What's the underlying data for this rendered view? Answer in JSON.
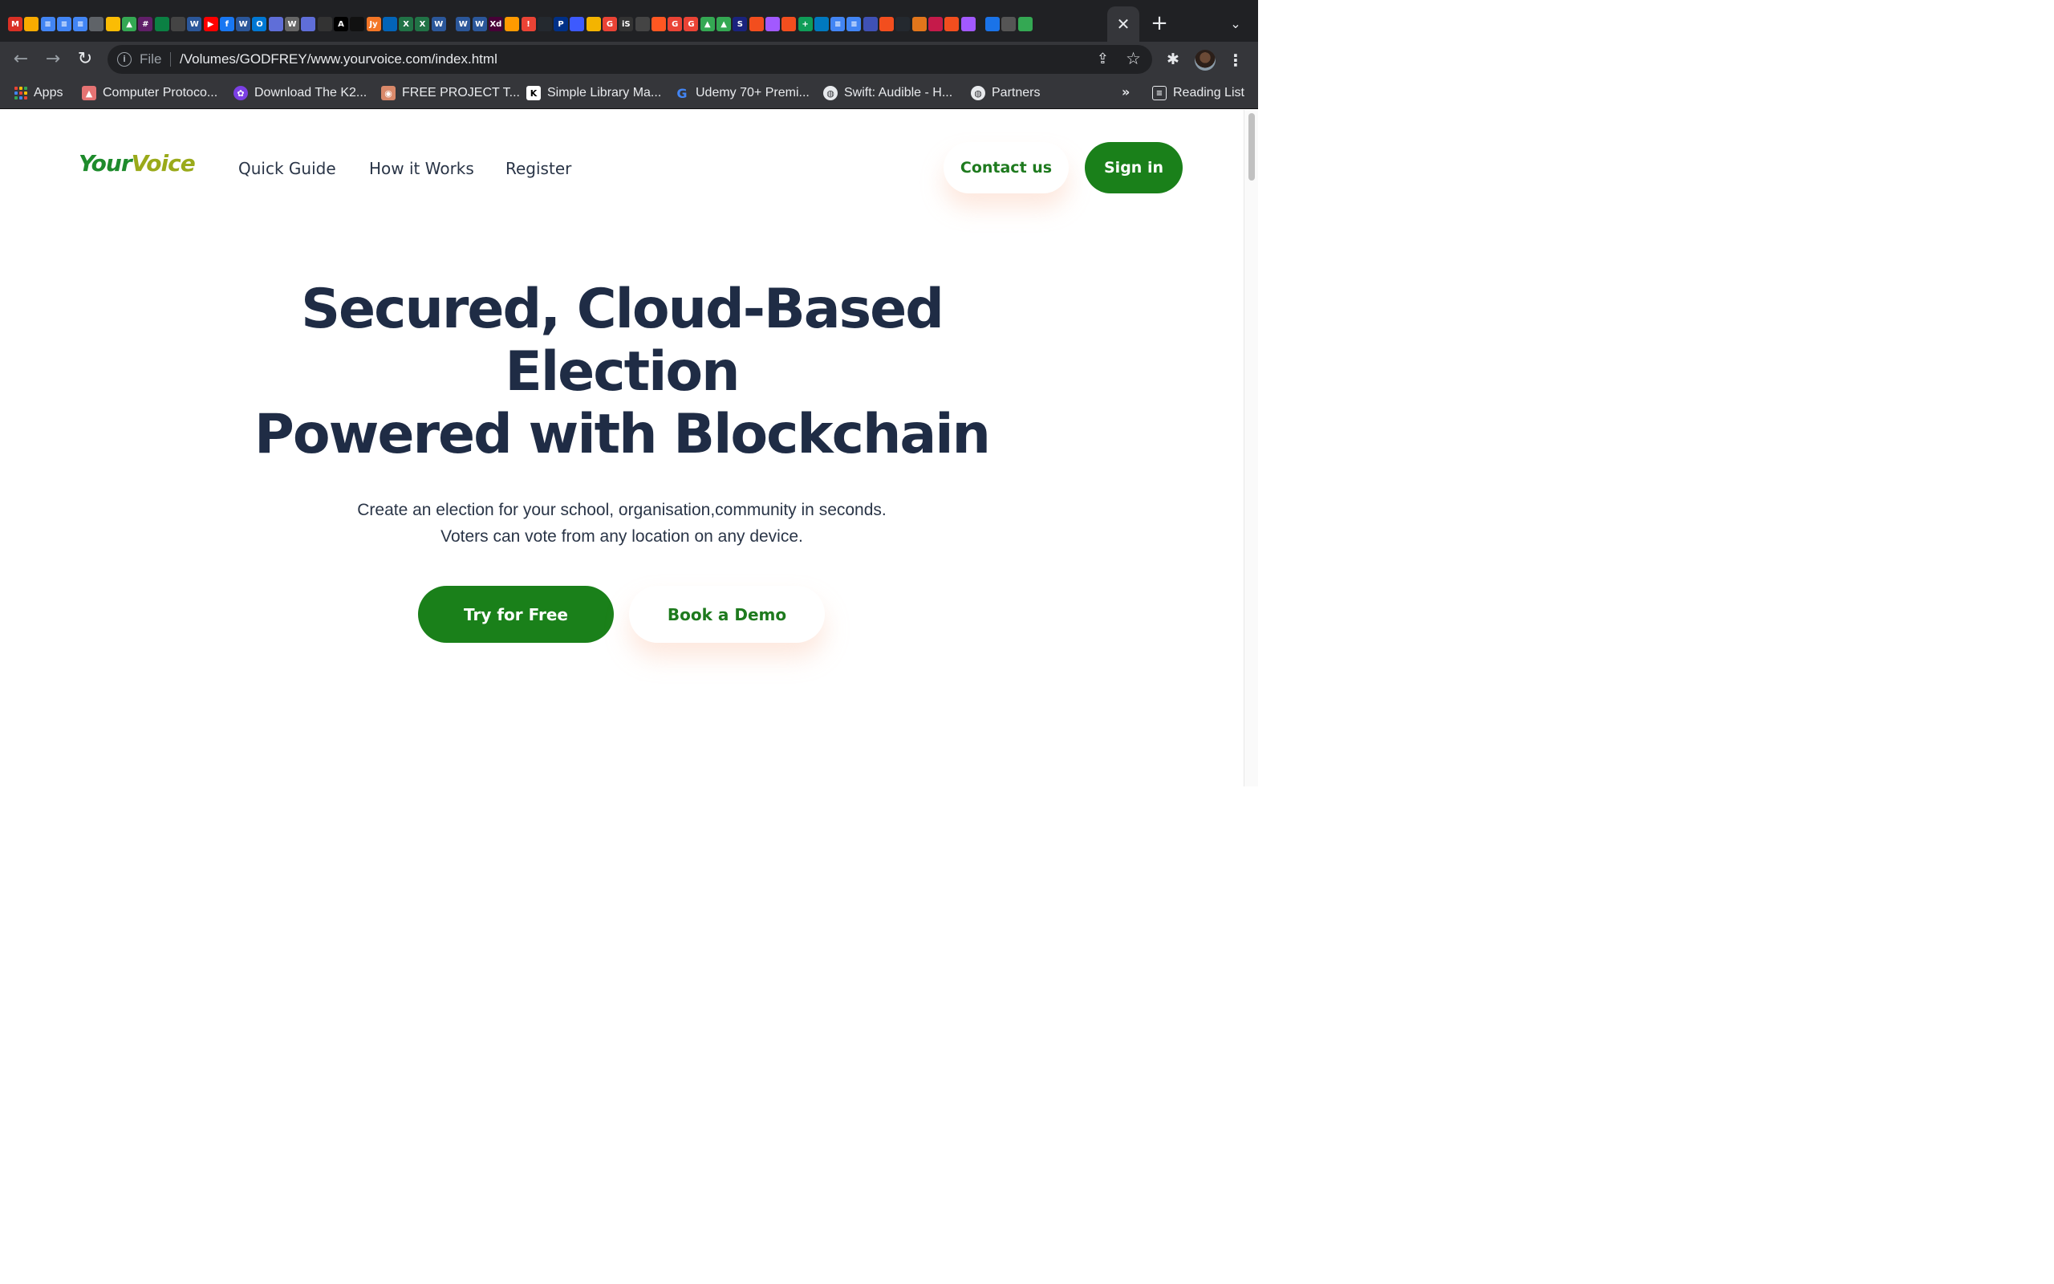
{
  "browser": {
    "tab_close_glyph": "✕",
    "new_tab_glyph": "+",
    "tab_search_glyph": "⌄",
    "tab_favicons": [
      {
        "name": "gmail-icon",
        "letter": "M",
        "color": "#d93025"
      },
      {
        "name": "notes-icon",
        "letter": "",
        "color": "#f9ab00"
      },
      {
        "name": "docs-icon",
        "letter": "≡",
        "color": "#4285f4"
      },
      {
        "name": "docs-icon",
        "letter": "≡",
        "color": "#4285f4"
      },
      {
        "name": "docs-icon",
        "letter": "≡",
        "color": "#4285f4"
      },
      {
        "name": "paper-icon",
        "letter": "",
        "color": "#5f6368"
      },
      {
        "name": "keep-icon",
        "letter": "",
        "color": "#fbbc04"
      },
      {
        "name": "drive-icon",
        "letter": "▲",
        "color": "#34a853"
      },
      {
        "name": "slack-icon",
        "letter": "#",
        "color": "#611f69"
      },
      {
        "name": "app-icon",
        "letter": "",
        "color": "#0b8043"
      },
      {
        "name": "app-icon",
        "letter": "",
        "color": "#444444"
      },
      {
        "name": "word-icon",
        "letter": "W",
        "color": "#2b579a"
      },
      {
        "name": "youtube-icon",
        "letter": "▶",
        "color": "#ff0000"
      },
      {
        "name": "facebook-icon",
        "letter": "f",
        "color": "#1877f2"
      },
      {
        "name": "word-icon",
        "letter": "W",
        "color": "#2b579a"
      },
      {
        "name": "outlook-icon",
        "letter": "O",
        "color": "#0078d4"
      },
      {
        "name": "app-icon",
        "letter": "",
        "color": "#5f6ed8"
      },
      {
        "name": "wikipedia-icon",
        "letter": "W",
        "color": "#666666"
      },
      {
        "name": "app-icon",
        "letter": "",
        "color": "#5f6ed8"
      },
      {
        "name": "app-icon",
        "letter": "",
        "color": "#333333"
      },
      {
        "name": "app-icon",
        "letter": "A",
        "color": "#000000"
      },
      {
        "name": "app-icon",
        "letter": "",
        "color": "#111111"
      },
      {
        "name": "app-icon",
        "letter": "Jy",
        "color": "#f37626"
      },
      {
        "name": "onedrive-icon",
        "letter": "",
        "color": "#0364b8"
      },
      {
        "name": "excel-icon",
        "letter": "X",
        "color": "#217346"
      },
      {
        "name": "excel-icon",
        "letter": "X",
        "color": "#217346"
      },
      {
        "name": "word-icon",
        "letter": "W",
        "color": "#2b579a"
      },
      {
        "name": "separator",
        "letter": "",
        "color": "sep"
      },
      {
        "name": "word-icon",
        "letter": "W",
        "color": "#2b579a"
      },
      {
        "name": "word-icon",
        "letter": "W",
        "color": "#2b579a"
      },
      {
        "name": "xd-icon",
        "letter": "Xd",
        "color": "#470137"
      },
      {
        "name": "app-icon",
        "letter": "",
        "color": "#ff9a00"
      },
      {
        "name": "app-icon",
        "letter": "!",
        "color": "#ea4335"
      },
      {
        "name": "github-icon",
        "letter": "",
        "color": "#24292f"
      },
      {
        "name": "paypal-icon",
        "letter": "P",
        "color": "#003087"
      },
      {
        "name": "app-icon",
        "letter": "",
        "color": "#3d5afe"
      },
      {
        "name": "app-icon",
        "letter": "",
        "color": "#f4b400"
      },
      {
        "name": "google-icon",
        "letter": "G",
        "color": "#ea4335"
      },
      {
        "name": "app-icon",
        "letter": "iS",
        "color": "#333333"
      },
      {
        "name": "app-icon",
        "letter": "",
        "color": "#444444"
      },
      {
        "name": "app-icon",
        "letter": "",
        "color": "#ff5722"
      },
      {
        "name": "google-icon",
        "letter": "G",
        "color": "#ea4335"
      },
      {
        "name": "google-icon",
        "letter": "G",
        "color": "#ea4335"
      },
      {
        "name": "drive-icon",
        "letter": "▲",
        "color": "#34a853"
      },
      {
        "name": "drive-icon",
        "letter": "▲",
        "color": "#34a853"
      },
      {
        "name": "app-icon",
        "letter": "S",
        "color": "#1a237e"
      },
      {
        "name": "figma-icon",
        "letter": "",
        "color": "#f24e1e"
      },
      {
        "name": "figma-icon",
        "letter": "",
        "color": "#a259ff"
      },
      {
        "name": "figma-icon",
        "letter": "",
        "color": "#f24e1e"
      },
      {
        "name": "app-icon",
        "letter": "+",
        "color": "#0f9d58"
      },
      {
        "name": "trello-icon",
        "letter": "",
        "color": "#0079bf"
      },
      {
        "name": "docs-icon",
        "letter": "≡",
        "color": "#4285f4"
      },
      {
        "name": "docs-icon",
        "letter": "≡",
        "color": "#4285f4"
      },
      {
        "name": "app-icon",
        "letter": "",
        "color": "#3f51b5"
      },
      {
        "name": "figma-icon",
        "letter": "",
        "color": "#f24e1e"
      },
      {
        "name": "github-icon",
        "letter": "",
        "color": "#24292f"
      },
      {
        "name": "app-icon",
        "letter": "",
        "color": "#e2761b"
      },
      {
        "name": "raspberry-icon",
        "letter": "",
        "color": "#c51a4a"
      },
      {
        "name": "figma-icon",
        "letter": "",
        "color": "#f24e1e"
      },
      {
        "name": "figma-icon",
        "letter": "",
        "color": "#a259ff"
      },
      {
        "name": "separator",
        "letter": "",
        "color": "sep"
      },
      {
        "name": "app-icon",
        "letter": "",
        "color": "#1a73e8"
      },
      {
        "name": "app-icon",
        "letter": "",
        "color": "#555555"
      },
      {
        "name": "app-icon",
        "letter": "",
        "color": "#34a853"
      }
    ],
    "address_scheme": "File",
    "url": "/Volumes/GODFREY/www.yourvoice.com/index.html"
  },
  "bookmarks": [
    {
      "label": "Apps",
      "icon": "apps-grid-icon"
    },
    {
      "label": "Computer Protoco...",
      "icon": "bookmark-favicon"
    },
    {
      "label": "Download The K2...",
      "icon": "bookmark-favicon"
    },
    {
      "label": "FREE PROJECT T...",
      "icon": "bookmark-favicon"
    },
    {
      "label": "Simple Library Ma...",
      "icon": "bookmark-favicon"
    },
    {
      "label": "Udemy 70+ Premi...",
      "icon": "google-icon"
    },
    {
      "label": "Swift: Audible - H...",
      "icon": "globe-icon"
    },
    {
      "label": "Partners",
      "icon": "globe-icon"
    }
  ],
  "bookmarks_more": "»",
  "reading_list": "Reading List",
  "site": {
    "logo_part1": "Your",
    "logo_part2": "Voice",
    "nav": [
      "Quick Guide",
      "How it Works",
      "Register"
    ],
    "contact_label": "Contact us",
    "signin_label": "Sign in",
    "hero": {
      "line1": "Secured, Cloud-Based",
      "line2": "Election",
      "line3": "Powered with Blockchain",
      "subtitle": "Create an election for your school, organisation,community in seconds. Voters can vote from any location on any device."
    },
    "try_label": "Try for Free",
    "demo_label": "Book a Demo"
  },
  "colors": {
    "brand_green": "#1a801a",
    "logo_green": "#1e8b2c",
    "logo_lime": "#9aaa1a",
    "heading_navy": "#1f2c45",
    "chrome_dark": "#202124",
    "chrome_toolbar": "#35363a"
  }
}
